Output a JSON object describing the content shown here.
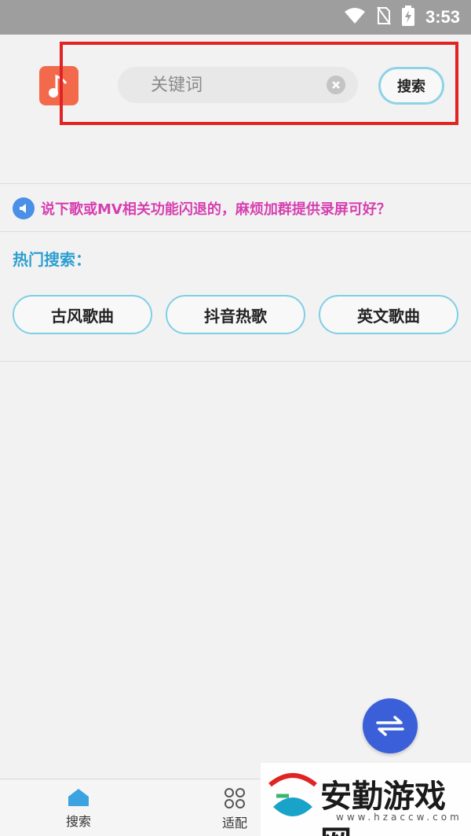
{
  "status_bar": {
    "time": "3:53"
  },
  "search": {
    "placeholder": "关键词",
    "button_label": "搜索"
  },
  "notice": {
    "text": "说下歌或MV相关功能闪退的，麻烦加群提供录屏可好？"
  },
  "hot": {
    "title": "热门搜索：",
    "tags": [
      "古风歌曲",
      "抖音热歌",
      "英文歌曲"
    ]
  },
  "nav": {
    "items": [
      {
        "label": "搜索",
        "icon": "home-icon"
      },
      {
        "label": "适配",
        "icon": "grid-icon"
      }
    ]
  },
  "watermark": {
    "text": "安勤游戏网",
    "url": "www.hzaccw.com"
  },
  "colors": {
    "accent": "#2d9fd0",
    "notice": "#d63fb0",
    "highlight": "#e02424",
    "logo": "#f26a4b",
    "fab": "#3a5fd8"
  }
}
